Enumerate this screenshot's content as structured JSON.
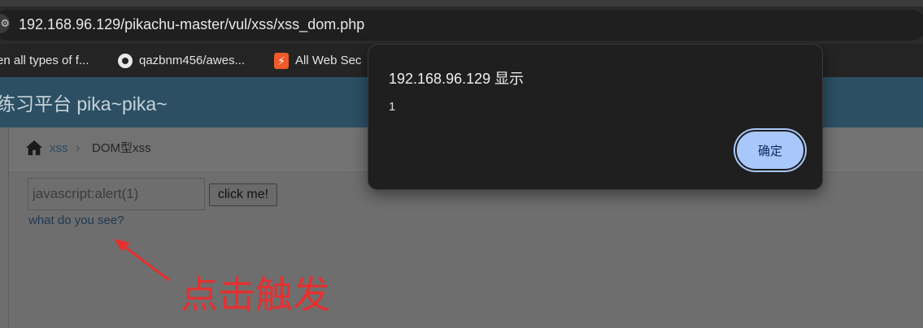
{
  "browser": {
    "url": "192.168.96.129/pikachu-master/vul/xss/xss_dom.php",
    "bookmarks": [
      {
        "label": "en all types of f...",
        "icon": "none"
      },
      {
        "label": "qazbnm456/awes...",
        "icon": "github-icon"
      },
      {
        "label": "All Web Sec",
        "icon": "flash-icon"
      }
    ]
  },
  "page": {
    "title": "练习平台 pika~pika~",
    "breadcrumb": {
      "link": "xss",
      "separator": "›",
      "current": "DOM型xss"
    },
    "form": {
      "input_value": "javascript:alert(1)",
      "button_label": "click me!"
    },
    "result_link": "what do you see?",
    "annotation": "点击触发",
    "annotation_color": "#e53030"
  },
  "dialog": {
    "title": "192.168.96.129 显示",
    "message": "1",
    "ok_label": "确定",
    "accent_color": "#a8c7fa"
  }
}
